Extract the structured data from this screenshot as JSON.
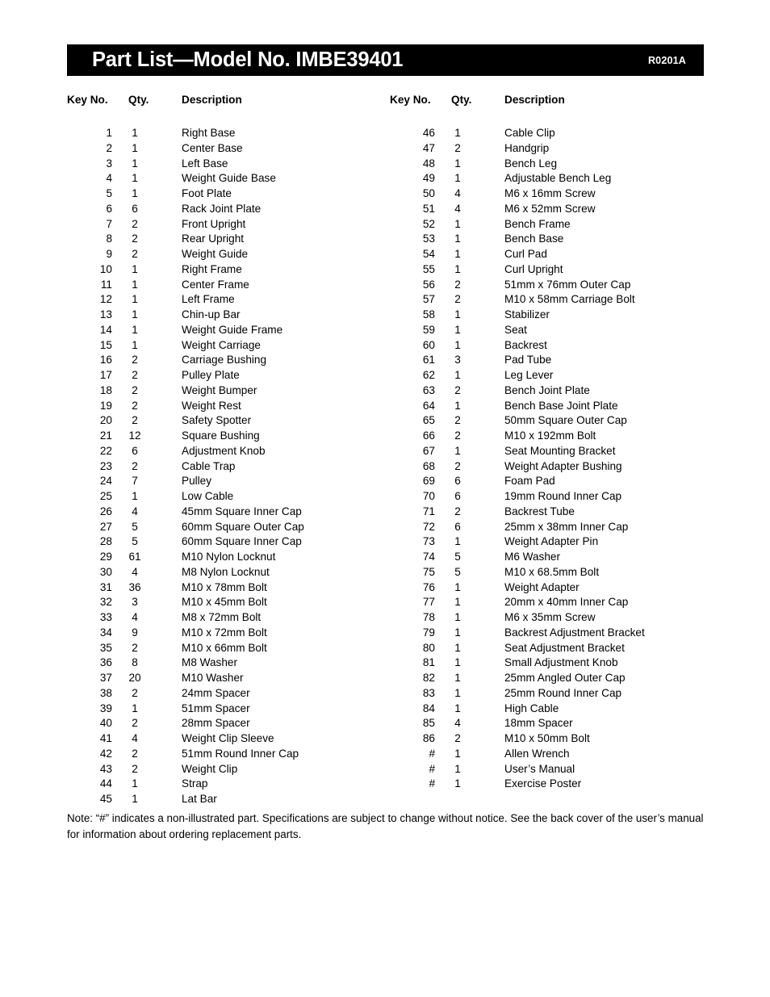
{
  "header": {
    "title": "Part List—Model No. IMBE39401",
    "revision_code": "R0201A",
    "background_color": "#000000",
    "text_color": "#ffffff"
  },
  "columns": {
    "key_no": "Key No.",
    "qty": "Qty.",
    "description": "Description"
  },
  "parts_left": [
    {
      "key": "1",
      "qty": "1",
      "desc": "Right Base"
    },
    {
      "key": "2",
      "qty": "1",
      "desc": "Center Base"
    },
    {
      "key": "3",
      "qty": "1",
      "desc": "Left Base"
    },
    {
      "key": "4",
      "qty": "1",
      "desc": "Weight Guide Base"
    },
    {
      "key": "5",
      "qty": "1",
      "desc": "Foot Plate"
    },
    {
      "key": "6",
      "qty": "6",
      "desc": "Rack Joint Plate"
    },
    {
      "key": "7",
      "qty": "2",
      "desc": "Front Upright"
    },
    {
      "key": "8",
      "qty": "2",
      "desc": "Rear Upright"
    },
    {
      "key": "9",
      "qty": "2",
      "desc": "Weight Guide"
    },
    {
      "key": "10",
      "qty": "1",
      "desc": "Right Frame"
    },
    {
      "key": "11",
      "qty": "1",
      "desc": "Center Frame"
    },
    {
      "key": "12",
      "qty": "1",
      "desc": "Left Frame"
    },
    {
      "key": "13",
      "qty": "1",
      "desc": "Chin-up Bar"
    },
    {
      "key": "14",
      "qty": "1",
      "desc": "Weight Guide Frame"
    },
    {
      "key": "15",
      "qty": "1",
      "desc": "Weight Carriage"
    },
    {
      "key": "16",
      "qty": "2",
      "desc": "Carriage Bushing"
    },
    {
      "key": "17",
      "qty": "2",
      "desc": "Pulley Plate"
    },
    {
      "key": "18",
      "qty": "2",
      "desc": "Weight Bumper"
    },
    {
      "key": "19",
      "qty": "2",
      "desc": "Weight Rest"
    },
    {
      "key": "20",
      "qty": "2",
      "desc": "Safety Spotter"
    },
    {
      "key": "21",
      "qty": "12",
      "desc": "Square Bushing"
    },
    {
      "key": "22",
      "qty": "6",
      "desc": "Adjustment Knob"
    },
    {
      "key": "23",
      "qty": "2",
      "desc": "Cable Trap"
    },
    {
      "key": "24",
      "qty": "7",
      "desc": "Pulley"
    },
    {
      "key": "25",
      "qty": "1",
      "desc": "Low Cable"
    },
    {
      "key": "26",
      "qty": "4",
      "desc": "45mm Square Inner Cap"
    },
    {
      "key": "27",
      "qty": "5",
      "desc": "60mm Square Outer Cap"
    },
    {
      "key": "28",
      "qty": "5",
      "desc": "60mm Square Inner Cap"
    },
    {
      "key": "29",
      "qty": "61",
      "desc": "M10 Nylon Locknut"
    },
    {
      "key": "30",
      "qty": "4",
      "desc": "M8 Nylon Locknut"
    },
    {
      "key": "31",
      "qty": "36",
      "desc": "M10 x 78mm Bolt"
    },
    {
      "key": "32",
      "qty": "3",
      "desc": "M10 x 45mm Bolt"
    },
    {
      "key": "33",
      "qty": "4",
      "desc": "M8 x 72mm Bolt"
    },
    {
      "key": "34",
      "qty": "9",
      "desc": "M10 x 72mm Bolt"
    },
    {
      "key": "35",
      "qty": "2",
      "desc": "M10 x 66mm Bolt"
    },
    {
      "key": "36",
      "qty": "8",
      "desc": "M8 Washer"
    },
    {
      "key": "37",
      "qty": "20",
      "desc": "M10 Washer"
    },
    {
      "key": "38",
      "qty": "2",
      "desc": "24mm Spacer"
    },
    {
      "key": "39",
      "qty": "1",
      "desc": "51mm Spacer"
    },
    {
      "key": "40",
      "qty": "2",
      "desc": "28mm Spacer"
    },
    {
      "key": "41",
      "qty": "4",
      "desc": "Weight Clip Sleeve"
    },
    {
      "key": "42",
      "qty": "2",
      "desc": "51mm Round Inner Cap"
    },
    {
      "key": "43",
      "qty": "2",
      "desc": "Weight Clip"
    },
    {
      "key": "44",
      "qty": "1",
      "desc": "Strap"
    },
    {
      "key": "45",
      "qty": "1",
      "desc": "Lat Bar"
    }
  ],
  "parts_right": [
    {
      "key": "46",
      "qty": "1",
      "desc": "Cable Clip"
    },
    {
      "key": "47",
      "qty": "2",
      "desc": "Handgrip"
    },
    {
      "key": "48",
      "qty": "1",
      "desc": "Bench Leg"
    },
    {
      "key": "49",
      "qty": "1",
      "desc": "Adjustable Bench Leg"
    },
    {
      "key": "50",
      "qty": "4",
      "desc": "M6 x 16mm Screw"
    },
    {
      "key": "51",
      "qty": "4",
      "desc": "M6 x 52mm Screw"
    },
    {
      "key": "52",
      "qty": "1",
      "desc": "Bench Frame"
    },
    {
      "key": "53",
      "qty": "1",
      "desc": "Bench Base"
    },
    {
      "key": "54",
      "qty": "1",
      "desc": "Curl Pad"
    },
    {
      "key": "55",
      "qty": "1",
      "desc": "Curl Upright"
    },
    {
      "key": "56",
      "qty": "2",
      "desc": "51mm x 76mm Outer Cap"
    },
    {
      "key": "57",
      "qty": "2",
      "desc": "M10 x 58mm Carriage Bolt"
    },
    {
      "key": "58",
      "qty": "1",
      "desc": "Stabilizer"
    },
    {
      "key": "59",
      "qty": "1",
      "desc": "Seat"
    },
    {
      "key": "60",
      "qty": "1",
      "desc": "Backrest"
    },
    {
      "key": "61",
      "qty": "3",
      "desc": "Pad Tube"
    },
    {
      "key": "62",
      "qty": "1",
      "desc": "Leg Lever"
    },
    {
      "key": "63",
      "qty": "2",
      "desc": "Bench Joint Plate"
    },
    {
      "key": "64",
      "qty": "1",
      "desc": "Bench Base Joint Plate"
    },
    {
      "key": "65",
      "qty": "2",
      "desc": "50mm Square Outer Cap"
    },
    {
      "key": "66",
      "qty": "2",
      "desc": "M10 x 192mm Bolt"
    },
    {
      "key": "67",
      "qty": "1",
      "desc": "Seat Mounting Bracket"
    },
    {
      "key": "68",
      "qty": "2",
      "desc": "Weight Adapter Bushing"
    },
    {
      "key": "69",
      "qty": "6",
      "desc": "Foam Pad"
    },
    {
      "key": "70",
      "qty": "6",
      "desc": "19mm Round Inner Cap"
    },
    {
      "key": "71",
      "qty": "2",
      "desc": "Backrest Tube"
    },
    {
      "key": "72",
      "qty": "6",
      "desc": "25mm x 38mm Inner Cap"
    },
    {
      "key": "73",
      "qty": "1",
      "desc": "Weight Adapter Pin"
    },
    {
      "key": "74",
      "qty": "5",
      "desc": "M6 Washer"
    },
    {
      "key": "75",
      "qty": "5",
      "desc": "M10 x 68.5mm Bolt"
    },
    {
      "key": "76",
      "qty": "1",
      "desc": "Weight Adapter"
    },
    {
      "key": "77",
      "qty": "1",
      "desc": "20mm x 40mm Inner Cap"
    },
    {
      "key": "78",
      "qty": "1",
      "desc": "M6 x 35mm Screw"
    },
    {
      "key": "79",
      "qty": "1",
      "desc": "Backrest Adjustment Bracket"
    },
    {
      "key": "80",
      "qty": "1",
      "desc": "Seat Adjustment Bracket"
    },
    {
      "key": "81",
      "qty": "1",
      "desc": "Small Adjustment Knob"
    },
    {
      "key": "82",
      "qty": "1",
      "desc": "25mm Angled Outer Cap"
    },
    {
      "key": "83",
      "qty": "1",
      "desc": "25mm Round Inner Cap"
    },
    {
      "key": "84",
      "qty": "1",
      "desc": "High Cable"
    },
    {
      "key": "85",
      "qty": "4",
      "desc": "18mm Spacer"
    },
    {
      "key": "86",
      "qty": "2",
      "desc": "M10 x 50mm Bolt"
    },
    {
      "key": "#",
      "qty": "1",
      "desc": "Allen Wrench"
    },
    {
      "key": "#",
      "qty": "1",
      "desc": "User’s Manual"
    },
    {
      "key": "#",
      "qty": "1",
      "desc": "Exercise Poster"
    }
  ],
  "footnote": "Note: “#” indicates a non-illustrated part. Specifications are subject to change without notice. See the back cover of the user’s manual for information about ordering replacement parts."
}
